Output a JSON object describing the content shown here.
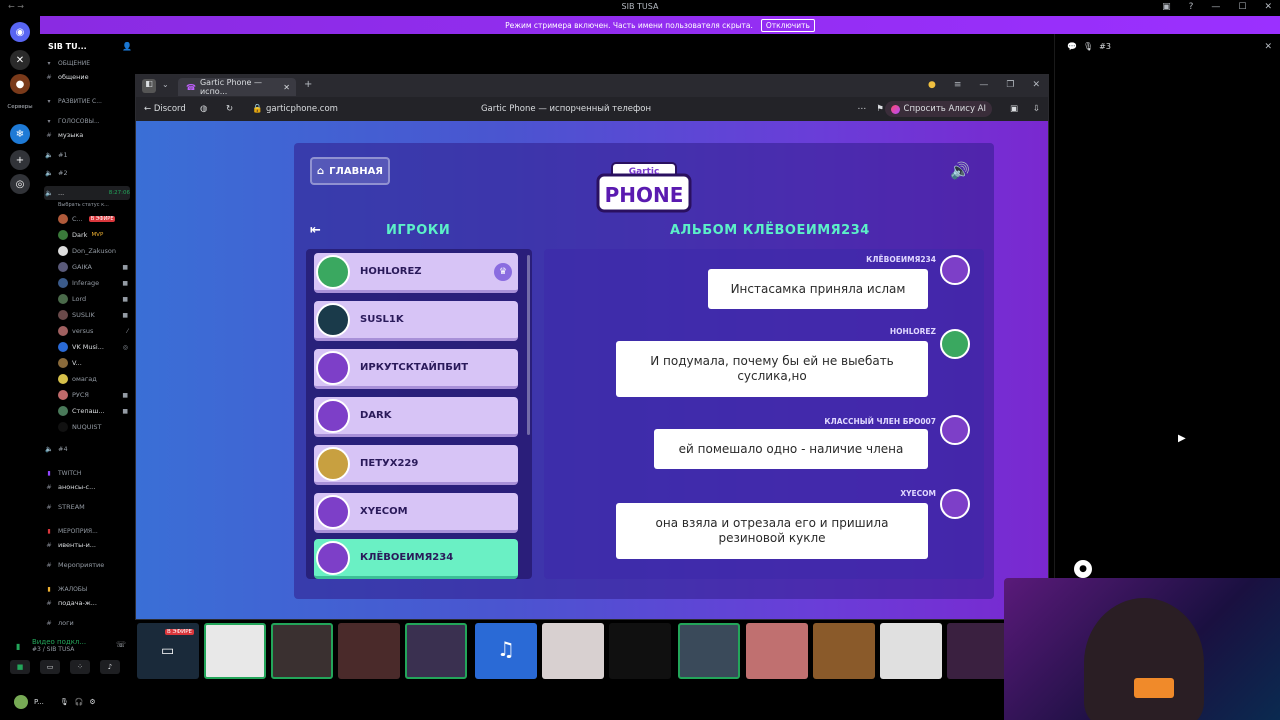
{
  "window": {
    "title": "SIB TUSA"
  },
  "banner": {
    "text": "Режим стримера включен. Часть имени пользователя скрыта.",
    "button": "Отключить"
  },
  "rail": {
    "servers_label": "Серверы"
  },
  "sidebar": {
    "server_name": "SIB TU...",
    "items": [
      {
        "icon": "#",
        "label": "ОБЩЕНИЕ",
        "kind": "cat"
      },
      {
        "icon": "#",
        "label": "общение",
        "kind": "text"
      },
      {
        "icon": "#",
        "label": "РАЗВИТИЕ С...",
        "kind": "cat"
      },
      {
        "icon": "#",
        "label": "ГОЛОСОВЫ...",
        "kind": "cat"
      },
      {
        "icon": "#",
        "label": "музыка",
        "kind": "text"
      },
      {
        "icon": "◂",
        "label": "#1",
        "kind": "voice"
      },
      {
        "icon": "◂",
        "label": "#2",
        "kind": "voice"
      },
      {
        "icon": "◂",
        "label": "...",
        "kind": "voice-active",
        "time": "8:27:06"
      },
      {
        "icon": "",
        "label": "Выбрать статус к...",
        "kind": "status"
      }
    ],
    "members": [
      {
        "name": "C...",
        "live": "В ЭФИРЕ"
      },
      {
        "name": "Dark",
        "badge": "MVP"
      },
      {
        "name": "Don_Zakuson"
      },
      {
        "name": "GAIKA"
      },
      {
        "name": "Inferage"
      },
      {
        "name": "Lord"
      },
      {
        "name": "SUSLIK"
      },
      {
        "name": "versus"
      },
      {
        "name": "VK Musi..."
      },
      {
        "name": "V..."
      },
      {
        "name": "омагад"
      },
      {
        "name": "РУСЯ"
      },
      {
        "name": "Степаш..."
      },
      {
        "name": "NUQUIST"
      }
    ],
    "after": [
      {
        "icon": "◂",
        "label": "#4",
        "kind": "voice"
      },
      {
        "icon": "",
        "label": "TWITCH",
        "kind": "cat"
      },
      {
        "icon": "#",
        "label": "анонсы-с...",
        "kind": "text"
      },
      {
        "icon": "#",
        "label": "STREAM",
        "kind": "text"
      },
      {
        "icon": "",
        "label": "МЕРОПРИЯ...",
        "kind": "cat"
      },
      {
        "icon": "#",
        "label": "ивенты-и...",
        "kind": "text"
      },
      {
        "icon": "#",
        "label": "Мероприятие",
        "kind": "text"
      },
      {
        "icon": "",
        "label": "ЖАЛОБЫ",
        "kind": "cat"
      },
      {
        "icon": "#",
        "label": "подача-ж...",
        "kind": "text"
      },
      {
        "icon": "#",
        "label": "логи",
        "kind": "text"
      }
    ],
    "voice_status": "Видео подкл...",
    "voice_sub": "#3 / SIB TUSA",
    "user": "P..."
  },
  "browser": {
    "tab_title": "Gartic Phone — испо...",
    "back_label": "Discord",
    "url": "garticphone.com",
    "page_title": "Gartic Phone — испорченный телефон",
    "alice": "Спросить Алису AI"
  },
  "game": {
    "home": "ГЛАВНАЯ",
    "logo_top": "Gartic",
    "logo_main": "PHONE",
    "players_heading": "ИГРОКИ",
    "album_heading": "АЛЬБОМ КЛЁВОЕИМЯ234",
    "players": [
      {
        "name": "HOHLOREZ",
        "host": true
      },
      {
        "name": "SUSL1K"
      },
      {
        "name": "ИРКУТСКТАЙПБИТ"
      },
      {
        "name": "DARK"
      },
      {
        "name": "ПЕТУХ229"
      },
      {
        "name": "XYECOM"
      },
      {
        "name": "КЛЁВОЕИМЯ234",
        "me": true
      }
    ],
    "messages": [
      {
        "author": "КЛЁВОЕИМЯ234",
        "text": "Инстасамка приняла ислам"
      },
      {
        "author": "HOHLOREZ",
        "text": "И подумала, почему бы ей не выебать суслика,но"
      },
      {
        "author": "КЛАССНЫЙ ЧЛЕН БРО007",
        "text": "ей помешало одно - наличие члена"
      },
      {
        "author": "XYECOM",
        "text": "она взяла и отрезала его и пришила резиновой кукле"
      }
    ]
  },
  "strip": {
    "live": "В ЭФИРЕ"
  },
  "right": {
    "channel": "#3"
  }
}
